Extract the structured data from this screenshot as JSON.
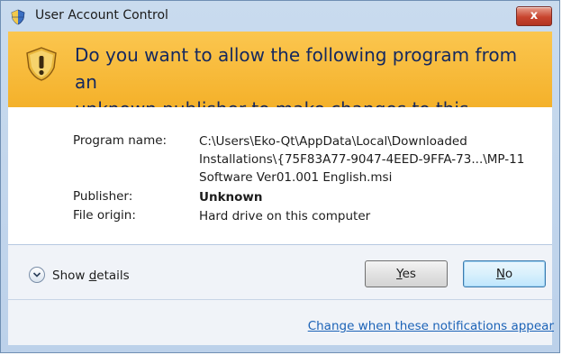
{
  "window": {
    "title": "User Account Control",
    "close_label": "x",
    "colors": {
      "banner": "#f4b12a",
      "title_bar": "#bcd1ea",
      "link": "#1c63b7"
    }
  },
  "banner": {
    "line1": "Do you want to allow the following program from an",
    "line2": "unknown publisher to make changes to this computer?",
    "icon": "shield-warning-icon"
  },
  "details": {
    "program_name_label": "Program name:",
    "program_name_lines": [
      "C:\\Users\\Eko-Qt\\AppData\\Local\\Downloaded",
      "Installations\\{75F83A77-9047-4EED-9FFA-73...\\MP-11",
      "Software Ver01.001 English.msi"
    ],
    "publisher_label": "Publisher:",
    "publisher_value": "Unknown",
    "file_origin_label": "File origin:",
    "file_origin_value": "Hard drive on this computer"
  },
  "actions": {
    "show_details_prefix": "Show ",
    "show_details_underline": "d",
    "show_details_suffix": "etails",
    "yes_underline": "Y",
    "yes_rest": "es",
    "no_underline": "N",
    "no_rest": "o"
  },
  "footer": {
    "link": "Change when these notifications appear"
  }
}
